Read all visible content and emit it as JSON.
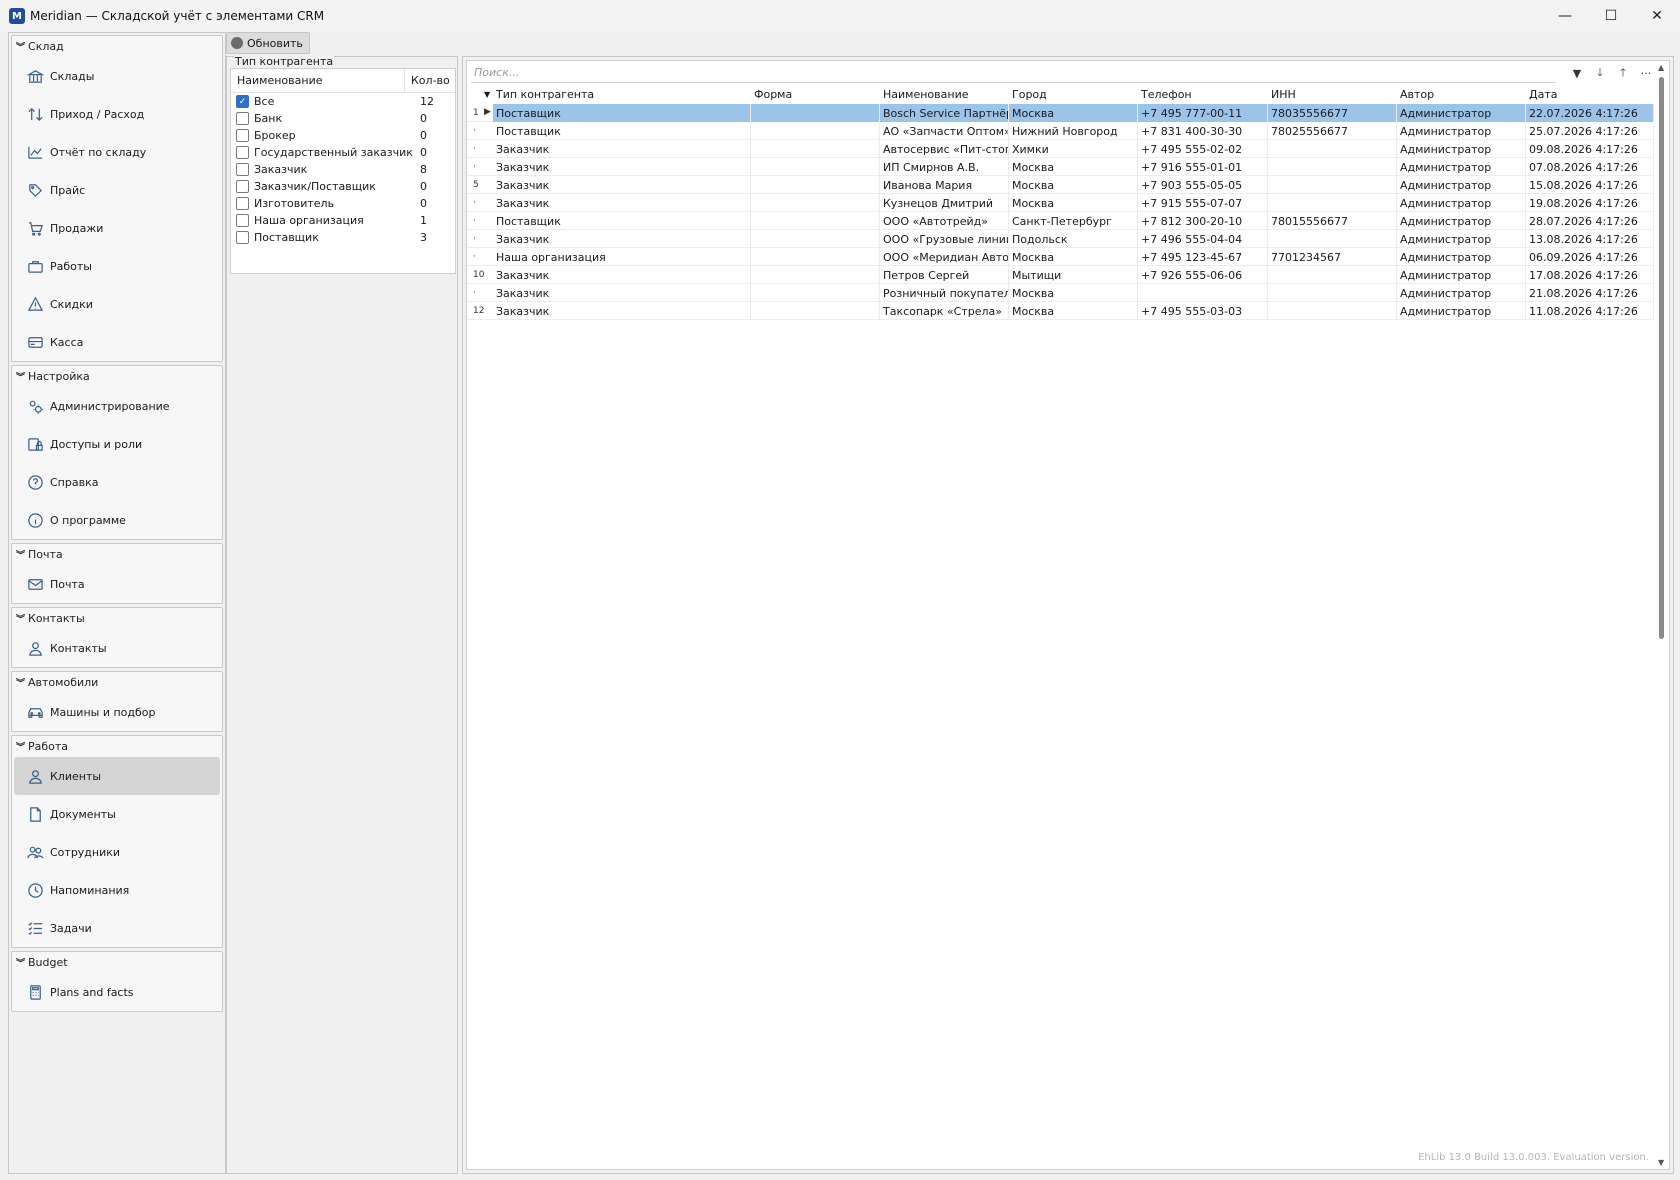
{
  "window": {
    "title": "Meridian — Складской учёт с элементами CRM",
    "icon_letter": "M",
    "minimize": "—",
    "maximize": "☐",
    "close": "✕"
  },
  "nav": {
    "groups": [
      {
        "title": "Склад",
        "items": [
          {
            "label": "Склады",
            "icon": "bank-icon"
          },
          {
            "label": "Приход / Расход",
            "icon": "arrows-icon"
          },
          {
            "label": "Отчёт по складу",
            "icon": "chart-icon"
          },
          {
            "label": "Прайс",
            "icon": "tag-icon"
          },
          {
            "label": "Продажи",
            "icon": "cart-icon"
          },
          {
            "label": "Работы",
            "icon": "briefcase-icon"
          },
          {
            "label": "Скидки",
            "icon": "warning-icon"
          },
          {
            "label": "Касса",
            "icon": "card-icon"
          }
        ]
      },
      {
        "title": "Настройка",
        "items": [
          {
            "label": "Администрирование",
            "icon": "gears-icon"
          },
          {
            "label": "Доступы и роли",
            "icon": "user-lock-icon"
          },
          {
            "label": "Справка",
            "icon": "help-icon"
          },
          {
            "label": "О программе",
            "icon": "info-icon"
          }
        ]
      },
      {
        "title": "Почта",
        "items": [
          {
            "label": "Почта",
            "icon": "mail-icon"
          }
        ]
      },
      {
        "title": "Контакты",
        "items": [
          {
            "label": "Контакты",
            "icon": "person-icon"
          }
        ]
      },
      {
        "title": "Автомобили",
        "items": [
          {
            "label": "Машины и подбор",
            "icon": "car-icon"
          }
        ]
      },
      {
        "title": "Работа",
        "items": [
          {
            "label": "Клиенты",
            "icon": "person-icon",
            "active": true
          },
          {
            "label": "Документы",
            "icon": "document-icon"
          },
          {
            "label": "Сотрудники",
            "icon": "people-icon"
          },
          {
            "label": "Напоминания",
            "icon": "clock-icon"
          },
          {
            "label": "Задачи",
            "icon": "checklist-icon"
          }
        ]
      },
      {
        "title": "Budget",
        "items": [
          {
            "label": "Plans and facts",
            "icon": "calculator-icon"
          }
        ]
      }
    ]
  },
  "toolbar": {
    "refresh_label": "Обновить"
  },
  "filter": {
    "caption": "Тип контрагента",
    "col_name": "Наименование",
    "col_count": "Кол-во",
    "rows": [
      {
        "name": "Все",
        "count": "12",
        "checked": true
      },
      {
        "name": "Банк",
        "count": "0",
        "checked": false
      },
      {
        "name": "Брокер",
        "count": "0",
        "checked": false
      },
      {
        "name": "Государственный заказчик",
        "count": "0",
        "checked": false
      },
      {
        "name": "Заказчик",
        "count": "8",
        "checked": false
      },
      {
        "name": "Заказчик/Поставщик",
        "count": "0",
        "checked": false
      },
      {
        "name": "Изготовитель",
        "count": "0",
        "checked": false
      },
      {
        "name": "Наша организация",
        "count": "1",
        "checked": false
      },
      {
        "name": "Поставщик",
        "count": "3",
        "checked": false
      }
    ]
  },
  "grid": {
    "search_placeholder": "Поиск...",
    "toolbar_icons": [
      "filter-icon",
      "arrow-down-icon",
      "arrow-up-icon",
      "more-icon"
    ],
    "columns": [
      "Тип контрагента",
      "Форма",
      "Наименование",
      "Город",
      "Телефон",
      "ИНН",
      "Автор",
      "Дата"
    ],
    "rows": [
      {
        "rn": "1",
        "type": "Поставщик",
        "form": "",
        "name": "Bosch Service Партнёр",
        "city": "Москва",
        "phone": "+7 495 777-00-11",
        "inn": "78035556677",
        "author": "Администратор",
        "date": "22.07.2026 4:17:26",
        "selected": true
      },
      {
        "rn": "·",
        "type": "Поставщик",
        "form": "",
        "name": "АО «Запчасти Оптом»",
        "city": "Нижний Новгород",
        "phone": "+7 831 400-30-30",
        "inn": "78025556677",
        "author": "Администратор",
        "date": "25.07.2026 4:17:26"
      },
      {
        "rn": "·",
        "type": "Заказчик",
        "form": "",
        "name": "Автосервис «Пит-стоп»",
        "city": "Химки",
        "phone": "+7 495 555-02-02",
        "inn": "",
        "author": "Администратор",
        "date": "09.08.2026 4:17:26"
      },
      {
        "rn": "·",
        "type": "Заказчик",
        "form": "",
        "name": "ИП Смирнов А.В.",
        "city": "Москва",
        "phone": "+7 916 555-01-01",
        "inn": "",
        "author": "Администратор",
        "date": "07.08.2026 4:17:26"
      },
      {
        "rn": "5",
        "type": "Заказчик",
        "form": "",
        "name": "Иванова Мария",
        "city": "Москва",
        "phone": "+7 903 555-05-05",
        "inn": "",
        "author": "Администратор",
        "date": "15.08.2026 4:17:26"
      },
      {
        "rn": "·",
        "type": "Заказчик",
        "form": "",
        "name": "Кузнецов Дмитрий",
        "city": "Москва",
        "phone": "+7 915 555-07-07",
        "inn": "",
        "author": "Администратор",
        "date": "19.08.2026 4:17:26"
      },
      {
        "rn": "·",
        "type": "Поставщик",
        "form": "",
        "name": "ООО «Автотрейд»",
        "city": "Санкт-Петербург",
        "phone": "+7 812 300-20-10",
        "inn": "78015556677",
        "author": "Администратор",
        "date": "28.07.2026 4:17:26"
      },
      {
        "rn": "·",
        "type": "Заказчик",
        "form": "",
        "name": "ООО «Грузовые линии»",
        "city": "Подольск",
        "phone": "+7 496 555-04-04",
        "inn": "",
        "author": "Администратор",
        "date": "13.08.2026 4:17:26"
      },
      {
        "rn": "·",
        "type": "Наша организация",
        "form": "",
        "name": "ООО «Меридиан Автоз",
        "city": "Москва",
        "phone": "+7 495 123-45-67",
        "inn": "7701234567",
        "author": "Администратор",
        "date": "06.09.2026 4:17:26"
      },
      {
        "rn": "10",
        "type": "Заказчик",
        "form": "",
        "name": "Петров Сергей",
        "city": "Мытищи",
        "phone": "+7 926 555-06-06",
        "inn": "",
        "author": "Администратор",
        "date": "17.08.2026 4:17:26"
      },
      {
        "rn": "·",
        "type": "Заказчик",
        "form": "",
        "name": "Розничный покупатель",
        "city": "Москва",
        "phone": "",
        "inn": "",
        "author": "Администратор",
        "date": "21.08.2026 4:17:26"
      },
      {
        "rn": "12",
        "type": "Заказчик",
        "form": "",
        "name": "Таксопарк «Стрела»",
        "city": "Москва",
        "phone": "+7 495 555-03-03",
        "inn": "",
        "author": "Администратор",
        "date": "11.08.2026 4:17:26"
      }
    ],
    "watermark": "EhLib 13.0 Build 13.0.003. Evaluation version."
  }
}
